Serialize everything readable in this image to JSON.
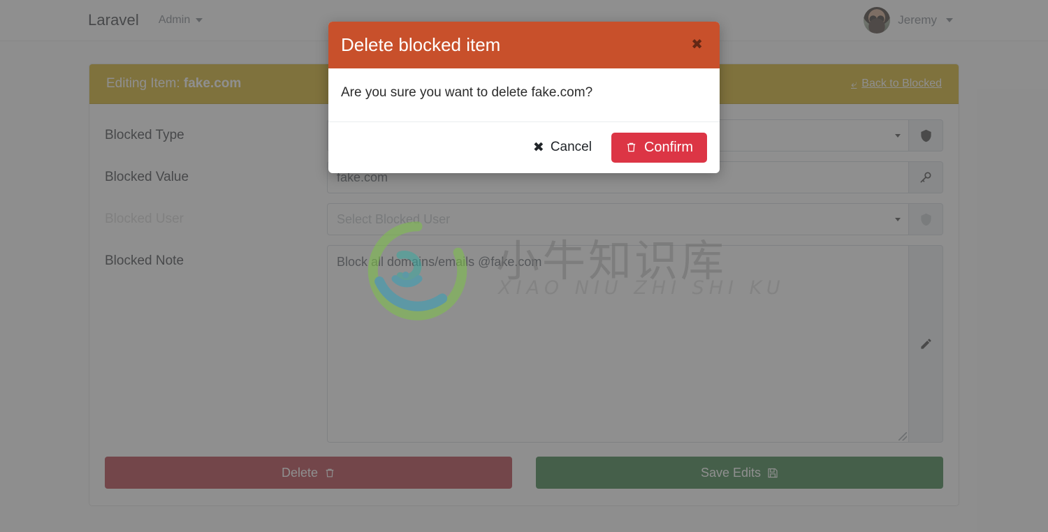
{
  "navbar": {
    "brand": "Laravel",
    "admin_label": "Admin",
    "user_name": "Jeremy",
    "avatar_icon": "avatar",
    "caret_icon": "chevron-down-icon"
  },
  "card": {
    "header_prefix": "Editing Item:",
    "header_item": "fake.com",
    "back_link": "Back to Blocked",
    "back_icon": "reply-arrow-icon",
    "header_bg": "#cca400"
  },
  "form": {
    "fields": [
      {
        "label": "Blocked Type",
        "value": "",
        "placeholder": "",
        "type": "select",
        "addon_icon": "shield-icon",
        "disabled": false
      },
      {
        "label": "Blocked Value",
        "value": "fake.com",
        "placeholder": "",
        "type": "text",
        "addon_icon": "key-icon",
        "disabled": false
      },
      {
        "label": "Blocked User",
        "value": "",
        "placeholder": "Select Blocked User",
        "type": "select",
        "addon_icon": "shield-icon",
        "disabled": true
      }
    ],
    "note": {
      "label": "Blocked Note",
      "value": "Block all domains/emails @fake.com",
      "addon_icon": "pencil-icon"
    }
  },
  "buttons": {
    "delete": {
      "label": "Delete",
      "icon": "trash-icon",
      "color": "#a71d2a"
    },
    "save": {
      "label": "Save Edits",
      "icon": "save-icon",
      "color": "#1a6b2a"
    }
  },
  "modal": {
    "title": "Delete blocked item",
    "close_icon": "close-icon",
    "body": "Are you sure you want to delete fake.com?",
    "cancel": {
      "label": "Cancel",
      "icon": "close-icon"
    },
    "confirm": {
      "label": "Confirm",
      "icon": "trash-icon",
      "color": "#dc3545"
    },
    "header_bg": "#c8502b"
  },
  "watermark": {
    "chinese": "小牛知识库",
    "pinyin": "XIAO NIU ZHI SHI KU"
  }
}
